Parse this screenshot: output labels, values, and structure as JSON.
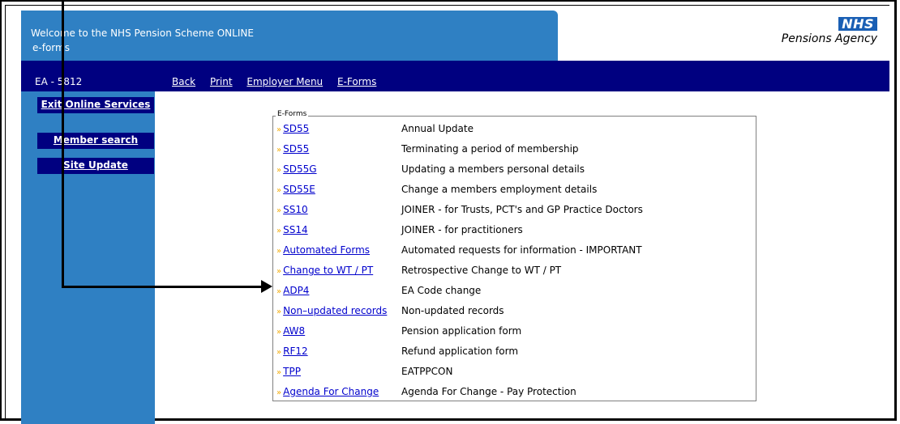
{
  "header": {
    "welcome_line1": "Welcome to the NHS Pension Scheme ONLINE",
    "welcome_line2": "e-forms",
    "logo_nhs": "NHS",
    "logo_agency": "Pensions Agency"
  },
  "navbar": {
    "ea_code": "EA - 5812",
    "links": [
      "Back",
      "Print",
      "Employer Menu",
      "E-Forms"
    ]
  },
  "sidebar": {
    "buttons": [
      "Exit Online Services",
      "Member search",
      "Site Update"
    ]
  },
  "eforms": {
    "legend": "E-Forms",
    "rows": [
      {
        "link": "SD55",
        "desc": "Annual Update"
      },
      {
        "link": "SD55",
        "desc": "Terminating a period of membership"
      },
      {
        "link": "SD55G",
        "desc": "Updating a members personal details"
      },
      {
        "link": "SD55E",
        "desc": "Change a members employment details"
      },
      {
        "link": "SS10",
        "desc": "JOINER - for Trusts, PCT's and GP Practice Doctors"
      },
      {
        "link": "SS14",
        "desc": "JOINER - for practitioners"
      },
      {
        "link": "Automated Forms",
        "desc": "Automated requests for information - IMPORTANT"
      },
      {
        "link": "Change to WT / PT",
        "desc": "Retrospective Change to WT / PT"
      },
      {
        "link": "ADP4",
        "desc": "EA Code change"
      },
      {
        "link": "Non–updated records",
        "desc": "Non-updated records"
      },
      {
        "link": "AW8",
        "desc": "Pension application form"
      },
      {
        "link": "RF12",
        "desc": "Refund application form"
      },
      {
        "link": "TPP",
        "desc": "EATPPCON"
      },
      {
        "link": "Agenda For Change",
        "desc": "Agenda For Change - Pay Protection"
      }
    ]
  },
  "colors": {
    "header_blue": "#2f80c3",
    "navy": "#000080",
    "link_blue": "#0000cc",
    "chevron": "#f2a900"
  },
  "icons": {
    "row_bullet": "chevron-right-icon",
    "annotation": "arrow-icon"
  }
}
